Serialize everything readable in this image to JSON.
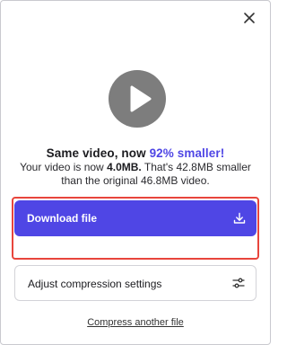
{
  "dialog": {
    "close_icon": "close-icon",
    "preview_icon": "play-icon",
    "headline_prefix": "Same video, now ",
    "headline_accent": "92% smaller!",
    "sub_part1": "Your video is now ",
    "sub_size": "4.0MB.",
    "sub_part2": " That's 42.8MB smaller than the original 46.8MB video.",
    "download_label": "Download file",
    "download_icon": "download-icon",
    "settings_label": "Adjust compression settings",
    "settings_icon": "sliders-icon",
    "another_label": "Compress another file",
    "accent_color": "#4f46e5",
    "highlight_color": "#e8453c"
  }
}
